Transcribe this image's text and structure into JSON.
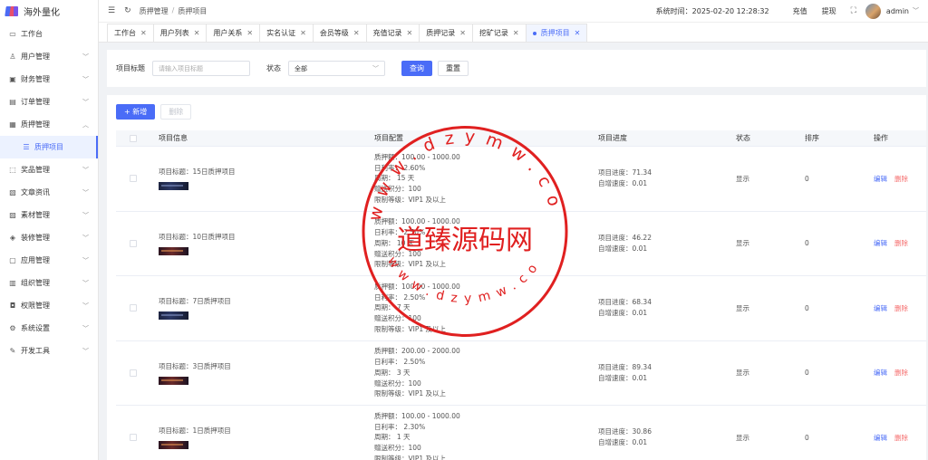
{
  "brand": {
    "title": "海外量化"
  },
  "sidebar": {
    "items": [
      {
        "label": "工作台",
        "icon": "monitor-icon",
        "arrow": ""
      },
      {
        "label": "用户管理",
        "icon": "user-icon",
        "arrow": "﹀"
      },
      {
        "label": "财务管理",
        "icon": "wallet-icon",
        "arrow": "﹀"
      },
      {
        "label": "订单管理",
        "icon": "order-icon",
        "arrow": "﹀"
      },
      {
        "label": "质押管理",
        "icon": "pledge-icon",
        "arrow": "︿"
      },
      {
        "label": "质押项目",
        "icon": "list-icon",
        "arrow": "",
        "sub": true
      },
      {
        "label": "奖品管理",
        "icon": "gift-icon",
        "arrow": "﹀"
      },
      {
        "label": "文章资讯",
        "icon": "article-icon",
        "arrow": "﹀"
      },
      {
        "label": "素材管理",
        "icon": "image-icon",
        "arrow": "﹀"
      },
      {
        "label": "装修管理",
        "icon": "decor-icon",
        "arrow": "﹀"
      },
      {
        "label": "应用管理",
        "icon": "app-icon",
        "arrow": "﹀"
      },
      {
        "label": "组织管理",
        "icon": "org-icon",
        "arrow": "﹀"
      },
      {
        "label": "权限管理",
        "icon": "lock-icon",
        "arrow": "﹀"
      },
      {
        "label": "系统设置",
        "icon": "gear-icon",
        "arrow": "﹀"
      },
      {
        "label": "开发工具",
        "icon": "tool-icon",
        "arrow": "﹀"
      }
    ]
  },
  "topbar": {
    "breadcrumb": [
      "质押管理",
      "质押项目"
    ],
    "breadcrumb_sep": "/",
    "system_time": "系统时间：2025-02-20 12:28:32",
    "recharge": "充值",
    "withdraw": "提现",
    "username": "admin"
  },
  "tabs": [
    {
      "label": "工作台",
      "active": false
    },
    {
      "label": "用户列表",
      "active": false
    },
    {
      "label": "用户关系",
      "active": false
    },
    {
      "label": "实名认证",
      "active": false
    },
    {
      "label": "会员等级",
      "active": false
    },
    {
      "label": "充值记录",
      "active": false
    },
    {
      "label": "质押记录",
      "active": false
    },
    {
      "label": "挖矿记录",
      "active": false
    },
    {
      "label": "质押项目",
      "active": true
    }
  ],
  "filter": {
    "title_label": "项目标题",
    "title_placeholder": "请输入项目标题",
    "status_label": "状态",
    "status_value": "全部",
    "query": "查询",
    "reset": "重置"
  },
  "toolbar": {
    "add": "+ 新增",
    "delete": "删除"
  },
  "table": {
    "headers": {
      "info": "项目信息",
      "config": "项目配置",
      "progress": "项目进度",
      "status": "状态",
      "sort": "排序",
      "ops": "操作"
    },
    "rows": [
      {
        "title": "项目标题：15日质押项目",
        "amount": "质押额：100.00 - 1000.00",
        "rate": "日利率： 2.60%",
        "period": "周期： 15 天",
        "bonus": "赠送积分：100",
        "level": "限制等级：VIP1 及以上",
        "progress": "项目进度：71.34",
        "auto_inc": "自增速度：0.01",
        "status": "显示",
        "sort": "0",
        "thumb": "cool"
      },
      {
        "title": "项目标题：10日质押项目",
        "amount": "质押额：100.00 - 1000.00",
        "rate": "日利率： 2.50%",
        "period": "周期： 10 天",
        "bonus": "赠送积分：100",
        "level": "限制等级：VIP1 及以上",
        "progress": "项目进度：46.22",
        "auto_inc": "自增速度：0.01",
        "status": "显示",
        "sort": "0",
        "thumb": "warm"
      },
      {
        "title": "项目标题：7日质押项目",
        "amount": "质押额：100.00 - 1000.00",
        "rate": "日利率： 2.50%",
        "period": "周期： 7 天",
        "bonus": "赠送积分：100",
        "level": "限制等级：VIP1 及以上",
        "progress": "项目进度：68.34",
        "auto_inc": "自增速度：0.01",
        "status": "显示",
        "sort": "0",
        "thumb": "cool"
      },
      {
        "title": "项目标题：3日质押项目",
        "amount": "质押额：200.00 - 2000.00",
        "rate": "日利率： 2.50%",
        "period": "周期： 3 天",
        "bonus": "赠送积分：100",
        "level": "限制等级：VIP1 及以上",
        "progress": "项目进度：89.34",
        "auto_inc": "自增速度：0.01",
        "status": "显示",
        "sort": "0",
        "thumb": "warm"
      },
      {
        "title": "项目标题：1日质押项目",
        "amount": "质押额：100.00 - 1000.00",
        "rate": "日利率： 2.30%",
        "period": "周期： 1 天",
        "bonus": "赠送积分：100",
        "level": "限制等级：VIP1 及以上",
        "progress": "项目进度：30.86",
        "auto_inc": "自增速度：0.01",
        "status": "显示",
        "sort": "0",
        "thumb": "warm"
      }
    ],
    "edit": "编辑",
    "delete": "删除"
  },
  "watermark": {
    "name": "道臻源码网",
    "url_top": "www.dzymw.com",
    "url_bottom": "www.dzymw.com",
    "color": "#e02020"
  }
}
